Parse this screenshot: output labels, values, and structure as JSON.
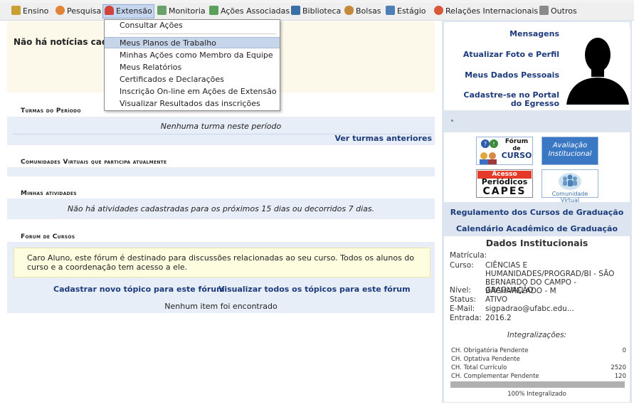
{
  "menu": {
    "items": [
      {
        "label": "Ensino",
        "icon": "book-stack-icon",
        "color": "#c8a034"
      },
      {
        "label": "Pesquisa",
        "icon": "flask-icon",
        "color": "#e0843a"
      },
      {
        "label": "Extensão",
        "icon": "heart-hands-icon",
        "color": "#d2443a",
        "active": true
      },
      {
        "label": "Monitoria",
        "icon": "monitor-person-icon",
        "color": "#6aa06a"
      },
      {
        "label": "Ações Associadas",
        "icon": "puzzle-icon",
        "color": "#5aa05a"
      },
      {
        "label": "Biblioteca",
        "icon": "library-icon",
        "color": "#3b6fa8"
      },
      {
        "label": "Bolsas",
        "icon": "person-icon",
        "color": "#c48a3a"
      },
      {
        "label": "Estágio",
        "icon": "clipboard-icon",
        "color": "#4c7fb8"
      },
      {
        "label": "Relações Internacionais",
        "icon": "globe-icon",
        "color": "#d8593a"
      },
      {
        "label": "Outros",
        "icon": "tools-icon",
        "color": "#8a8a8a"
      }
    ],
    "accent": "#c5d6ee"
  },
  "dropdown": {
    "items": [
      "Consultar Ações",
      "Meus Planos de Trabalho",
      "Minhas Ações como Membro da Equipe",
      "Meus Relatórios",
      "Certificados e Declarações",
      "Inscrição On-line em Ações de Extensão",
      "Visualizar Resultados das inscrições"
    ],
    "highlighted_index": 1
  },
  "news": {
    "title": "Não há notícias cadastradas"
  },
  "turmas": {
    "title": "Turmas do Período",
    "empty": "Nenhuma turma neste período",
    "link": "Ver turmas anteriores"
  },
  "comunidades": {
    "title": "Comunidades Virtuais que participa atualmente"
  },
  "atividades": {
    "title": "Minhas atividades",
    "empty": "Não há atividades cadastradas para os próximos 15 dias ou decorridos 7 dias."
  },
  "forum": {
    "title": "Forum de Cursos",
    "notice": "Caro Aluno, este fórum é destinado para discussões relacionadas ao seu curso. Todos os alunos do curso e a coordenação tem acesso a ele.",
    "new_topic": "Cadastrar novo tópico para este fórum",
    "view_all": "Visualizar todos os tópicos para este fórum",
    "empty": "Nenhum item foi encontrado"
  },
  "profile": {
    "links": [
      "Mensagens",
      "Atualizar Foto e Perfil",
      "Meus Dados Pessoais",
      "Cadastre-se no Portal do Egresso"
    ]
  },
  "logos": {
    "forum": {
      "line1": "Fórum",
      "line2": "de",
      "line3": "CURSO"
    },
    "avaliacao": {
      "line1": "Avaliação",
      "line2": "Institucional"
    },
    "capes": {
      "line1": "Acesso Externo",
      "line2": "Periódicos",
      "line3": "CAPES"
    },
    "comunidade": {
      "line1": "Comunidade Virtual"
    }
  },
  "links": {
    "regulamento": "Regulamento dos Cursos de Graduação",
    "calendario": "Calendário Acadêmico de Graduação"
  },
  "dados": {
    "title": "Dados Institucionais",
    "matricula_label": "Matrícula:",
    "matricula": "",
    "curso_label": "Curso:",
    "curso": "CIÊNCIAS E HUMANIDADES/PROGRAD/BI - SÃO BERNARDO DO CAMPO - BACHARELADO - M",
    "nivel_label": "Nível:",
    "nivel": "GRADUAÇÃO",
    "status_label": "Status:",
    "status": "ATIVO",
    "email_label": "E-Mail:",
    "email": "sigpadrao@ufabc.edu...",
    "entrada_label": "Entrada:",
    "entrada": "2016.2",
    "integralizacoes": "Integralizações:",
    "ch": [
      {
        "label": "CH. Obrigatória Pendente",
        "value": "0"
      },
      {
        "label": "CH. Optativa Pendente",
        "value": ""
      },
      {
        "label": "CH. Total Currículo",
        "value": "2520"
      },
      {
        "label": "CH. Complementar Pendente",
        "value": "120"
      }
    ],
    "integralizado_pct": 100,
    "integralizado_label": "100% Integralizado"
  }
}
